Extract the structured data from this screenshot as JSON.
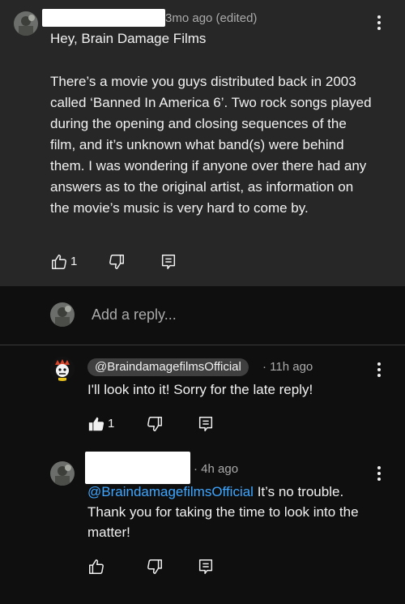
{
  "top_comment": {
    "time": "3mo ago (edited)",
    "greeting": "Hey, Brain Damage Films",
    "body": "There’s a movie you guys distributed back in 2003 called ‘Banned In America 6’. Two rock songs played during the opening and closing sequences of the film, and it’s unknown what band(s) were behind them. I was wondering if anyone over there had any answers as to the original artist, as information on the movie’s music is very hard to come by.",
    "likes": "1"
  },
  "reply_input": {
    "placeholder": "Add a reply..."
  },
  "replies": [
    {
      "author": "@BraindamagefilmsOfficial",
      "time": "· 11h ago",
      "text": "I'll look into it! Sorry for the late reply!",
      "likes": "1"
    },
    {
      "time": "· 4h ago",
      "mention": "@BraindamagefilmsOfficial",
      "text": " It’s no trouble. Thank you for taking the time to look into the matter!"
    }
  ],
  "colors": {
    "background": "#0f0f0f",
    "comment_background": "#272727",
    "mention": "#3ea6ff",
    "secondary_text": "#aaaaaa"
  },
  "icons": [
    "avatar",
    "more-vert-icon",
    "thumb-up-icon",
    "thumb-up-filled-icon",
    "thumb-down-icon",
    "comment-reply-icon"
  ]
}
